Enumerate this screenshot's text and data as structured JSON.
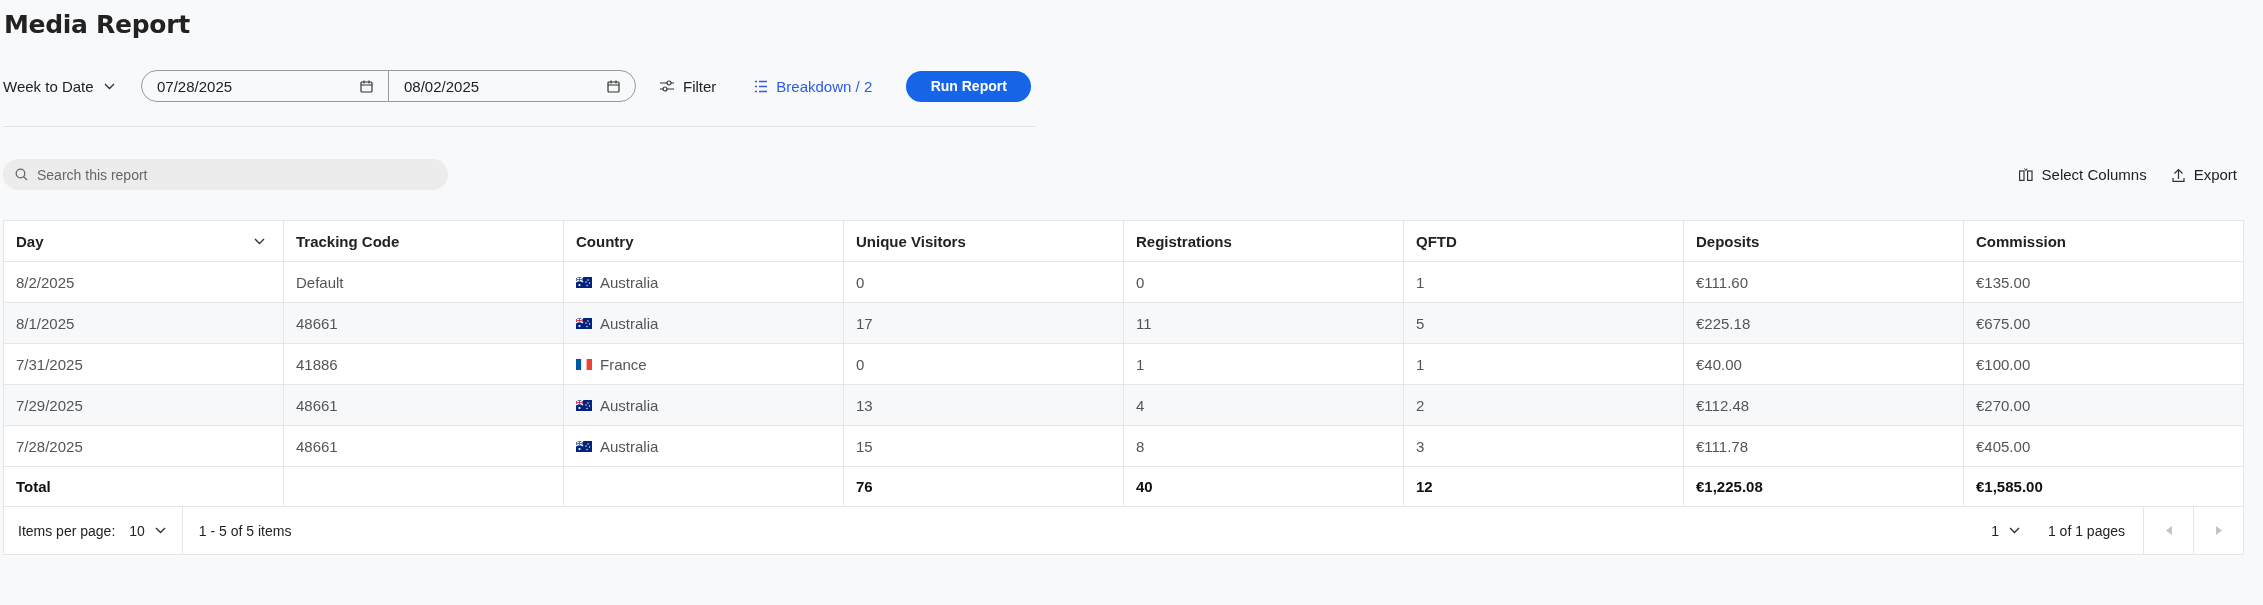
{
  "page": {
    "title": "Media Report"
  },
  "toolbar": {
    "period": "Week to Date",
    "start_date": "07/28/2025",
    "end_date": "08/02/2025",
    "filter": "Filter",
    "breakdown": "Breakdown / 2",
    "run": "Run Report"
  },
  "search": {
    "placeholder": "Search this report"
  },
  "actions": [
    "Select Columns",
    "Export"
  ],
  "table": {
    "columns": [
      {
        "label": "Day",
        "sortable": true
      },
      {
        "label": "Tracking Code",
        "sortable": false
      },
      {
        "label": "Country",
        "sortable": false
      },
      {
        "label": "Unique Visitors",
        "sortable": false
      },
      {
        "label": "Registrations",
        "sortable": false
      },
      {
        "label": "QFTD",
        "sortable": false
      },
      {
        "label": "Deposits",
        "sortable": false
      },
      {
        "label": "Commission",
        "sortable": false
      }
    ],
    "rows": [
      {
        "day": "8/2/2025",
        "code": "Default",
        "kind": "au",
        "country": "Australia",
        "visitors": "0",
        "registrations": "0",
        "qftd": "1",
        "deposits": "€111.60",
        "commission": "€135.00"
      },
      {
        "day": "8/1/2025",
        "code": "48661",
        "kind": "au",
        "country": "Australia",
        "visitors": "17",
        "registrations": "11",
        "qftd": "5",
        "deposits": "€225.18",
        "commission": "€675.00"
      },
      {
        "day": "7/31/2025",
        "code": "41886",
        "kind": "fr",
        "country": "France",
        "visitors": "0",
        "registrations": "1",
        "qftd": "1",
        "deposits": "€40.00",
        "commission": "€100.00"
      },
      {
        "day": "7/29/2025",
        "code": "48661",
        "kind": "au",
        "country": "Australia",
        "visitors": "13",
        "registrations": "4",
        "qftd": "2",
        "deposits": "€112.48",
        "commission": "€270.00"
      },
      {
        "day": "7/28/2025",
        "code": "48661",
        "kind": "au",
        "country": "Australia",
        "visitors": "15",
        "registrations": "8",
        "qftd": "3",
        "deposits": "€111.78",
        "commission": "€405.00"
      }
    ],
    "total": {
      "label": "Total",
      "visitors": "76",
      "registrations": "40",
      "qftd": "12",
      "deposits": "€1,225.08",
      "commission": "€1,585.00"
    }
  },
  "pager": {
    "items_label": "Items per page:",
    "page_size": "10",
    "range": "1 - 5 of 5 items",
    "page": "1",
    "pages": "1 of 1 pages",
    "prev_disabled": true,
    "next_disabled": true
  }
}
